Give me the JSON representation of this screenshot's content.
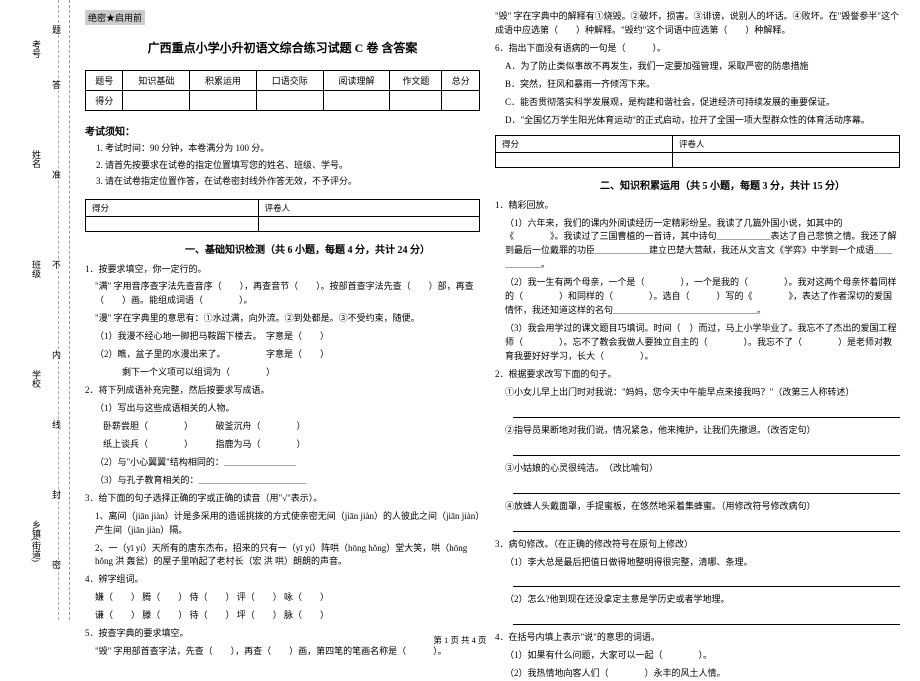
{
  "sidebar": {
    "labels": [
      "考号",
      "姓名",
      "班级",
      "学校",
      "乡镇(街道)"
    ],
    "hints": [
      "题",
      "答",
      "准",
      "不",
      "内",
      "线",
      "封",
      "密"
    ]
  },
  "secret": "绝密★启用前",
  "title": "广西重点小学小升初语文综合练习试题 C 卷  含答案",
  "score_table": {
    "headers": [
      "题号",
      "知识基础",
      "积累运用",
      "口语交际",
      "阅读理解",
      "作文题",
      "总分"
    ],
    "row2": "得分"
  },
  "notice_head": "考试须知：",
  "notice": [
    "考试时间：90 分钟，本卷满分为 100 分。",
    "请首先按要求在试卷的指定位置填写您的姓名、班级、学号。",
    "请在试卷指定位置作答，在试卷密封线外作答无效，不予评分。"
  ],
  "scorebox": {
    "c1": "得分",
    "c2": "评卷人"
  },
  "sec1": {
    "title": "一、基础知识检测（共 6 小题，每题 4 分，共计 24 分）",
    "q1": "1．按要求填空，你一定行的。",
    "q1a": "\"满\" 字用音序查字法先查音序（　　），再查音节（　　）。按部首查字法先查（　　）部，再查（　　）画。能组成词语（　　　　）。",
    "q1b": "\"漫\" 字在字典里的意思有：①水过满，向外流。②到处都是。③不受约束，随便。",
    "q1c": "（1）我漫不经心地一脚把马鞍踢下楼去。　字意是（　　）",
    "q1d": "（2）瞧，盆子里的水漫出来了。　　　　　字意是（　　）",
    "q1e": "　　　剩下一个义项可以组词为（　　　　）",
    "q2": "2．将下列成语补充完整，然后按要求写成语。",
    "q2a": "（1）写出与这些成语相关的人物。",
    "q2b1": "卧薪尝胆（　　　　）　　　破釜沉舟（　　　　）",
    "q2b2": "纸上谈兵（　　　　）　　　指鹿为马（　　　　）",
    "q2c": "（2）与\"小心翼翼\"结构相同的：＿＿＿＿＿＿＿＿",
    "q2d": "（3）与孔子教育相关的：＿＿＿＿＿＿＿＿＿＿＿＿",
    "q3": "3．给下面的句子选择正确的字或正确的读音（用\"√\"表示）。",
    "q3a": "1、离间（jiān  jiàn）计是多采用的造谣挑拨的方式使亲密无间（jiān  jiàn）的人彼此之间（jiān  jiàn）产生间（jiān  jiàn）隔。",
    "q3b": "2、一（yī  yí）天所有的唐东杰布，招来的只有一（yī  yí）阵哄（hōng  hǒng）堂大笑，哄（hōng  hǒng  洪  轰瓮）的屋子里响起了老村长（宏  洪  哄）朗朗的声音。",
    "q4": "4．辨字组词。",
    "q4a": "嫌（　　） 腾（　　） 侍（　　） 评（　　） 咏（　　）",
    "q4b": "谦（　　） 滕（　　） 待（　　） 坪（　　） 脉（　　）",
    "q5": "5．按查字典的要求填空。",
    "q5a": "\"毁\" 字用部首查字法，先查（　　），再查（　　）画，第四笔的笔画名称是（　　　）。"
  },
  "right": {
    "q5b": "\"毁\" 字在字典中的解释有①烧毁。②破坏，损害。③诽谤，说别人的坏话。④败坏。在\"毁誉参半\"这个成语中应选第（　　）种解释。\"毁约\"这个词语中应选第（　　）种解释。",
    "q6": "6．指出下面没有语病的一句是（　　　）。",
    "q6a": "A．为了防止类似事故不再发生，我们一定要加强管理，采取严密的防患措施",
    "q6b": "B．突然，狂风和暴雨一齐倾泻下来。",
    "q6c": "C．能否贯彻落实科学发展观，是构建和谐社会，促进经济可持续发展的重要保证。",
    "q6d": "D．\"全国亿万学生阳光体育运动\"的正式启动，拉开了全国一项大型群众性的体育活动序幕。",
    "sec2_title": "二、知识积累运用（共 5 小题，每题 3 分，共计 15 分）",
    "q1": "1．精彩回放。",
    "q1a": "（1）六年来，我们的课内外阅读经历一定精彩纷呈。我读了几篇外国小说，如其中的《　　　　》。我读过了三国曹植的一首诗，其中诗句＿＿＿＿＿＿表达了自己悲愤之情。我还了解到最后一位戴罪的功臣＿＿＿＿＿＿建立巴楚大营献，我还从文言文《学弈》中学到一个成语＿＿＿＿＿＿。",
    "q1b": "（2）我一生有两个母亲，一个是（　　　　），一个是我的（　　　　）。我对这两个母亲怀着同样的（　　　　）和同样的（　　　　）。选自（　　　）写的《　　　　》，表达了作者深切的爱国情怀，我还知道这样的名句＿＿＿＿＿＿＿＿＿＿＿＿＿＿＿＿。",
    "q1c": "（3）我会用学过的课文题目巧填词。时间（　）而过，马上小学毕业了。我忘不了杰出的爱国工程师（　　　　）。忘不了教会我做人要独立自主的（　　　　）。我忘不了（　　　　）是老师对教育我要好好学习，长大（　　　　）。",
    "q2": "2．根据要求改写下面的句子。",
    "q2a": "①小女儿早上出门时对我说：\"妈妈，您今天中午能早点来接我吗？\"（改第三人称转述）",
    "q2b": "②指导员果断地对我们说，情况紧急，他来掩护，让我们先撤退。（改否定句）",
    "q2c": "③小姑娘的心灵很纯洁。　（改比喻句）",
    "q2d": "④放蜂人头戴面罩，手提蜜板，在悠然地采着集蜂蜜。（用修改符号修改病句）",
    "q3": "3．病句修改。（在正确的修改符号在原句上修改）",
    "q3a": "（1）李大总是最后把值日做得地整明得很完整，清哪、条理。",
    "q3b": "（2）怎么?他到现在还没拿定主意是学历史或者学地理。",
    "q4": "4．在括号内填上表示\"说\"的意思的词语。",
    "q4a": "（1）如果有什么问题，大家可以一起（　　　　）。",
    "q4b": "（2）我热情地向客人们（　　　　）永丰的风土人情。"
  },
  "footer": "第 1 页 共 4 页"
}
